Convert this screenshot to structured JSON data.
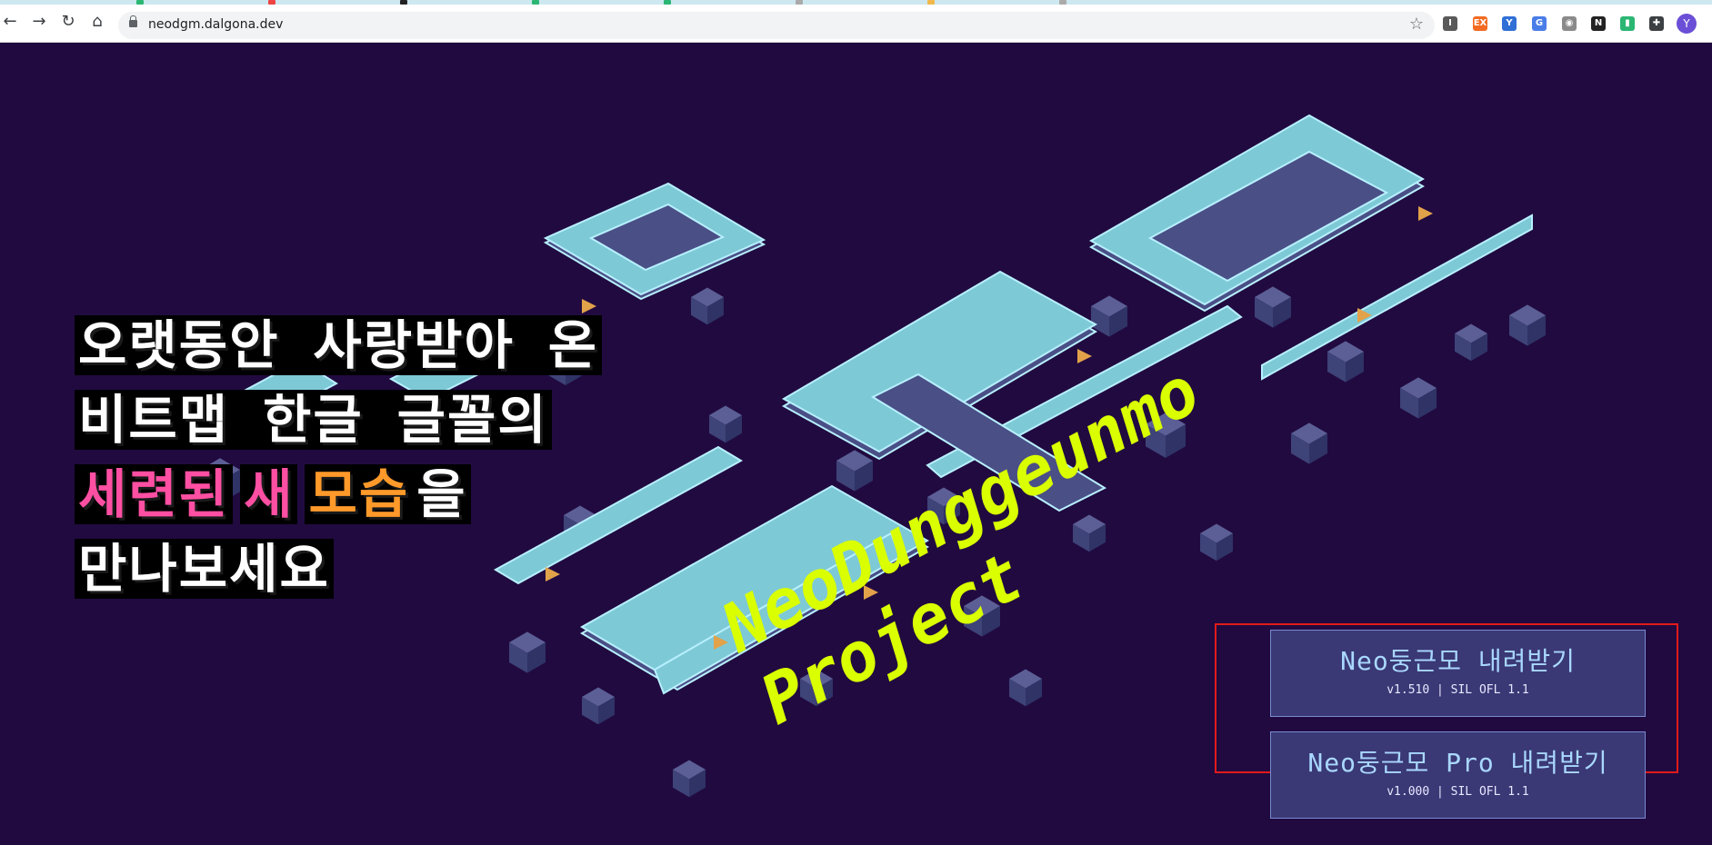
{
  "browser": {
    "url": "neodgm.dalgona.dev",
    "profile_initial": "Y",
    "nav_icons": [
      "back-icon",
      "forward-icon",
      "reload-icon",
      "home-icon"
    ],
    "extensions": [
      {
        "name": "instapaper-extension-icon",
        "label": "I",
        "color": "#5a5a5a"
      },
      {
        "name": "ex-extension-icon",
        "label": "EX",
        "color": "#f26a21"
      },
      {
        "name": "v-extension-icon",
        "label": "Y",
        "color": "#2f6fd6"
      },
      {
        "name": "translate-extension-icon",
        "label": "G",
        "color": "#4a7de8"
      },
      {
        "name": "camera-extension-icon",
        "label": "◉",
        "color": "#8a8a8a"
      },
      {
        "name": "notion-extension-icon",
        "label": "N",
        "color": "#222222"
      },
      {
        "name": "green-extension-icon",
        "label": "▮",
        "color": "#2bb673"
      },
      {
        "name": "puzzle-extension-icon",
        "label": "✚",
        "color": "#3c4043"
      }
    ]
  },
  "hero": {
    "lines": [
      [
        {
          "text": "오랫동안 사랑받아 온",
          "color": "white"
        }
      ],
      [
        {
          "text": "비트맵 한글 글꼴의",
          "color": "white"
        }
      ],
      [
        {
          "text": "세련된",
          "color": "pink"
        },
        {
          "text": " ",
          "color": "white"
        },
        {
          "text": "새",
          "color": "pink"
        },
        {
          "text": " ",
          "color": "white"
        },
        {
          "text": "모습",
          "color": "orange"
        },
        {
          "text": "을",
          "color": "white"
        }
      ],
      [
        {
          "text": "만나보세요",
          "color": "white"
        }
      ]
    ]
  },
  "wordmark": {
    "line1": "NeoDunggeunmo",
    "line2": "Project"
  },
  "downloads": [
    {
      "title": "Neo둥근모 내려받기",
      "subtitle": "v1.510 | SIL OFL 1.1"
    },
    {
      "title": "Neo둥근모 Pro 내려받기",
      "subtitle": "v1.000 | SIL OFL 1.1"
    }
  ],
  "colors": {
    "background": "#210a40",
    "accent_pink": "#ff4fa3",
    "accent_orange": "#ff9a2a",
    "wordmark": "#d9ff00",
    "button_bg": "#3a3875",
    "highlight_box": "#e21a1a"
  }
}
